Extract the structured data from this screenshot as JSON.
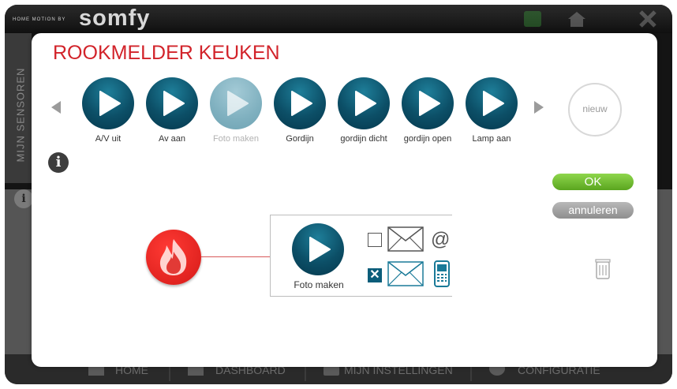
{
  "header": {
    "brand_prefix": "HOME MOTION BY",
    "brand": "somfy"
  },
  "sidebar": {
    "label": "MIJN SENSOREN"
  },
  "bottom_nav": [
    {
      "label": "HOME",
      "icon": "home-icon"
    },
    {
      "label": "DASHBOARD",
      "icon": "dashboard-icon"
    },
    {
      "label": "MIJN INSTELLINGEN",
      "icon": "user-icon"
    },
    {
      "label": "CONFIGURATIE",
      "icon": "gear-icon"
    }
  ],
  "dialog": {
    "title": "ROOKMELDER KEUKEN",
    "scenes": [
      {
        "label": "A/V uit",
        "state": "active"
      },
      {
        "label": "Av aan",
        "state": "active"
      },
      {
        "label": "Foto maken",
        "state": "disabled"
      },
      {
        "label": "Gordijn",
        "state": "active"
      },
      {
        "label": "gordijn dicht",
        "state": "active"
      },
      {
        "label": "gordijn open",
        "state": "active"
      },
      {
        "label": "Lamp aan",
        "state": "active"
      }
    ],
    "new_label": "nieuw",
    "ok_label": "OK",
    "cancel_label": "annuleren",
    "rule": {
      "trigger_icon": "fire-icon",
      "action_label": "Foto maken",
      "notifications": [
        {
          "type": "email",
          "checked": false,
          "icon": "envelope-at-icon"
        },
        {
          "type": "sms",
          "checked": true,
          "icon": "envelope-phone-icon"
        }
      ]
    }
  },
  "colors": {
    "title_red": "#d2232a",
    "scene_blue": "#0c4f67",
    "ok_green": "#6cba2f",
    "fire_red": "#e0201e"
  }
}
